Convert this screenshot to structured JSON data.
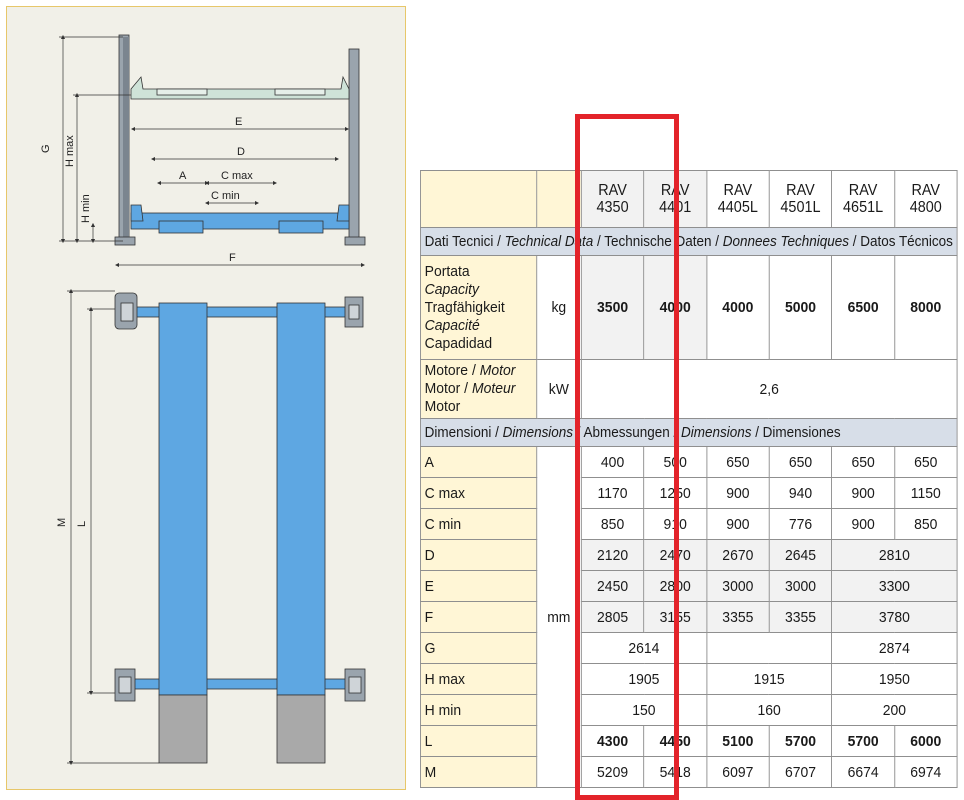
{
  "diagram": {
    "dimension_labels": {
      "G": "G",
      "Hmax": "H max",
      "Hmin": "H min",
      "E": "E",
      "D": "D",
      "A": "A",
      "Cmax": "C max",
      "Cmin": "C min",
      "F": "F",
      "M": "M",
      "L": "L"
    }
  },
  "table": {
    "models": [
      {
        "l1": "RAV",
        "l2": "4350"
      },
      {
        "l1": "RAV",
        "l2": "4401"
      },
      {
        "l1": "RAV",
        "l2": "4405L"
      },
      {
        "l1": "RAV",
        "l2": "4501L"
      },
      {
        "l1": "RAV",
        "l2": "4651L"
      },
      {
        "l1": "RAV",
        "l2": "4800"
      }
    ],
    "tech_header": {
      "p1": "Dati Tecnici / ",
      "p2": "Technical Data",
      "p3": " / Technische Daten / ",
      "p4": "Donnees Techniques",
      "p5": " / Datos Técnicos"
    },
    "capacity": {
      "labels": [
        "Portata",
        "Capacity",
        "Tragfähigkeit",
        "Capacité",
        "Capadidad"
      ],
      "unit": "kg",
      "values": [
        "3500",
        "4000",
        "4000",
        "5000",
        "6500",
        "8000"
      ]
    },
    "motor": {
      "line1a": "Motore / ",
      "line1b": "Motor",
      "line2a": "Motor / ",
      "line2b": "Moteur",
      "line3": "Motor",
      "unit": "kW",
      "value": "2,6"
    },
    "dim_header": {
      "p1": "Dimensioni / ",
      "p2": "Dimensions",
      "p3": " / Abmessungen / ",
      "p4": "Dimensions",
      "p5": " / Dimensiones"
    },
    "dim_unit": "mm",
    "rows": {
      "A": {
        "label": "A",
        "v": [
          "400",
          "500",
          "650",
          "650",
          "650",
          "650"
        ]
      },
      "Cmax": {
        "label": "C max",
        "v": [
          "1170",
          "1250",
          "900",
          "940",
          "900",
          "1150"
        ]
      },
      "Cmin": {
        "label": "C min",
        "v": [
          "850",
          "910",
          "900",
          "776",
          "900",
          "850"
        ]
      },
      "D": {
        "label": "D",
        "v": [
          "2120",
          "2470",
          "2670",
          "2645",
          "2810"
        ]
      },
      "E": {
        "label": "E",
        "v": [
          "2450",
          "2800",
          "3000",
          "3000",
          "3300"
        ]
      },
      "F": {
        "label": "F",
        "v": [
          "2805",
          "3155",
          "3355",
          "3355",
          "3780"
        ]
      },
      "G": {
        "label": "G",
        "v": [
          "2614",
          "2874"
        ]
      },
      "Hmax": {
        "label": "H max",
        "v": [
          "1905",
          "1915",
          "1950"
        ]
      },
      "Hmin": {
        "label": "H min",
        "v": [
          "150",
          "160",
          "200"
        ]
      },
      "L": {
        "label": "L",
        "v": [
          "4300",
          "4450",
          "5100",
          "5700",
          "5700",
          "6000"
        ]
      },
      "M": {
        "label": "M",
        "v": [
          "5209",
          "5418",
          "6097",
          "6707",
          "6674",
          "6974"
        ]
      }
    }
  },
  "colors": {
    "highlight": "#e3232a",
    "label_cell": "#fff6d6",
    "section_header": "#d7dee8",
    "runway_blue": "#5ea7e2",
    "panel_border": "#e7c76a"
  }
}
